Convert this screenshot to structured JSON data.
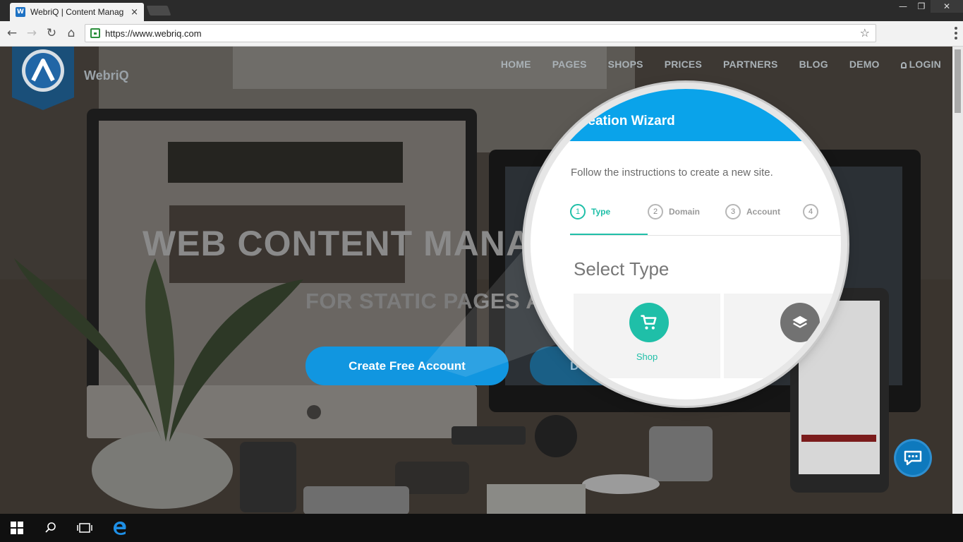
{
  "browser": {
    "tab_title": "WebriQ | Content Manag",
    "tab_close": "×",
    "favicon_letter": "W",
    "url": "https://www.webriq.com",
    "window_controls": {
      "minimize": "—",
      "restore": "❐",
      "close": "✕"
    },
    "nav_icons": {
      "back": "←",
      "forward": "→",
      "reload": "↻",
      "home": "⌂",
      "bookmark": "☆"
    }
  },
  "site": {
    "brand": "WebriQ",
    "nav": [
      "HOME",
      "PAGES",
      "SHOPS",
      "PRICES",
      "PARTNERS",
      "BLOG",
      "DEMO",
      "LOGIN"
    ],
    "hero_title": "WEB CONTENT MANAG",
    "hero_subtitle": "FOR STATIC PAGES AN",
    "cta_primary": "Create Free Account",
    "cta_secondary": "Dem"
  },
  "wizard": {
    "title": "reation Wizard",
    "instructions": "Follow the instructions to create a new site.",
    "steps": [
      {
        "num": "1",
        "label": "Type"
      },
      {
        "num": "2",
        "label": "Domain"
      },
      {
        "num": "3",
        "label": "Account"
      },
      {
        "num": "4",
        "label": ""
      }
    ],
    "active_step": 1,
    "section_title": "Select Type",
    "cards": [
      {
        "label": "Shop",
        "icon": "cart-icon"
      },
      {
        "label": "",
        "icon": "layers-icon"
      }
    ]
  },
  "colors": {
    "accent_blue": "#0aa3ea",
    "teal": "#1fbfa8",
    "cta_blue": "#1196e0"
  },
  "taskbar": {
    "items": [
      "start-icon",
      "search-icon",
      "task-view-icon",
      "edge-icon"
    ]
  }
}
